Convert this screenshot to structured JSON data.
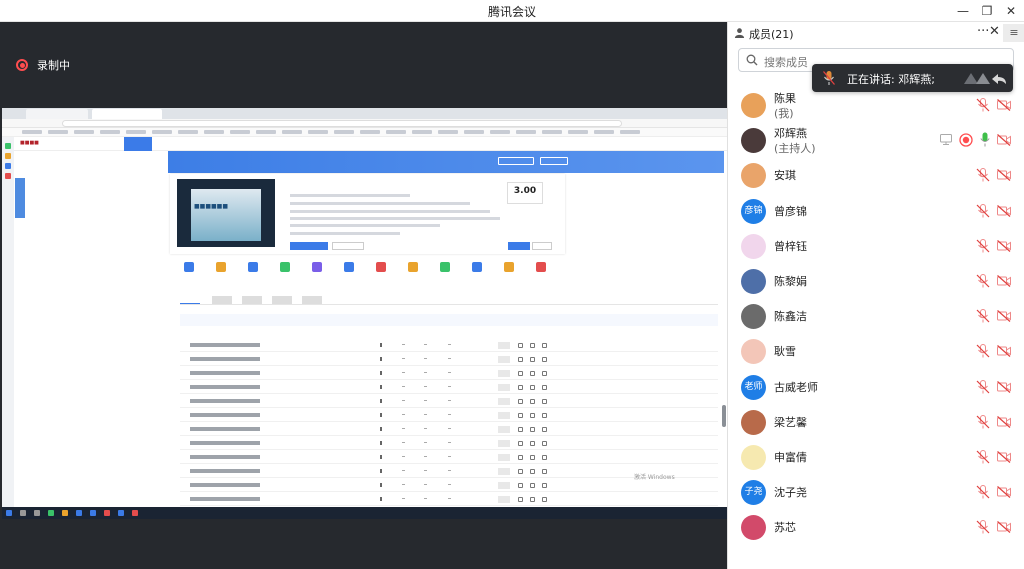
{
  "window": {
    "title": "腾讯会议",
    "min_icon": "minimize-icon",
    "max_icon": "restore-icon",
    "close_icon": "close-icon"
  },
  "stage": {
    "recording_label": "录制中"
  },
  "shared_screen": {
    "course_score": "3.00",
    "watermark_title": "激活 Windows"
  },
  "panel": {
    "title": "成员(21)",
    "more_label": "···",
    "close_label": "✕",
    "menu_label": "≡",
    "search_placeholder": "搜索成员",
    "speaking_label": "正在讲话: 邓辉燕;",
    "members": [
      {
        "name": "陈果",
        "role": "(我)",
        "avatar_text": "",
        "avatar_color": "#e8a15a"
      },
      {
        "name": "邓辉燕",
        "role": "(主持人)",
        "avatar_text": "",
        "avatar_color": "#4a3a3a"
      },
      {
        "name": "安琪",
        "role": "",
        "avatar_text": "",
        "avatar_color": "#e9a46a"
      },
      {
        "name": "曾彦锦",
        "role": "",
        "avatar_text": "彦锦",
        "avatar_color": "#1f7ee6"
      },
      {
        "name": "曾梓钰",
        "role": "",
        "avatar_text": "",
        "avatar_color": "#f1d6ec"
      },
      {
        "name": "陈黎娟",
        "role": "",
        "avatar_text": "",
        "avatar_color": "#4e6fa8"
      },
      {
        "name": "陈鑫洁",
        "role": "",
        "avatar_text": "",
        "avatar_color": "#6b6b6b"
      },
      {
        "name": "耿雪",
        "role": "",
        "avatar_text": "",
        "avatar_color": "#f3c6b8"
      },
      {
        "name": "古威老师",
        "role": "",
        "avatar_text": "老师",
        "avatar_color": "#1f7ee6"
      },
      {
        "name": "梁艺馨",
        "role": "",
        "avatar_text": "",
        "avatar_color": "#b86a4a"
      },
      {
        "name": "申富倩",
        "role": "",
        "avatar_text": "",
        "avatar_color": "#f6e9b0"
      },
      {
        "name": "沈子尧",
        "role": "",
        "avatar_text": "子尧",
        "avatar_color": "#1f7ee6"
      },
      {
        "name": "苏芯",
        "role": "",
        "avatar_text": "",
        "avatar_color": "#d24a6a"
      }
    ]
  },
  "colors": {
    "stage_bg": "#26292e",
    "record_red": "#ff4d4f",
    "muted_red": "#e0413f",
    "host_mic_green": "#3fbf4a",
    "accent_blue": "#1f7ee6"
  }
}
